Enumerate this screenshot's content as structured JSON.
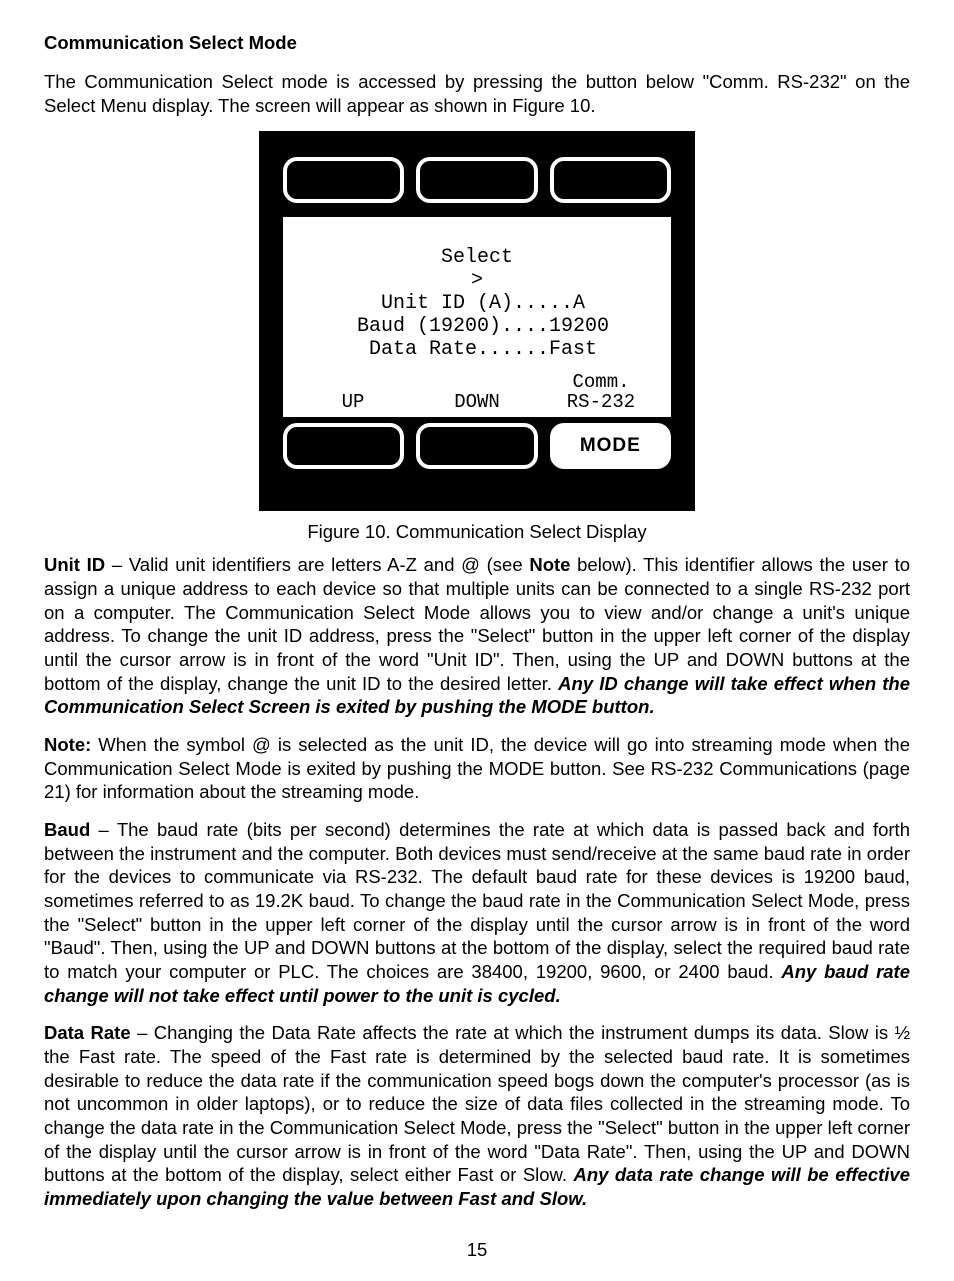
{
  "heading": "Communication Select Mode",
  "intro": "The Communication Select mode is accessed by pressing the button below \"Comm. RS-232\" on the Select Menu display. The screen will appear as shown in Figure 10.",
  "device": {
    "lcd": {
      "title": "Select",
      "cursor": ">",
      "lines": [
        " Unit ID (A).....A",
        " Baud (19200)....19200",
        " Data Rate......Fast"
      ],
      "soft_labels": {
        "left": "UP",
        "mid": "DOWN",
        "right_top": "Comm.",
        "right_bot": "RS-232"
      }
    },
    "bottom_button_label": "MODE"
  },
  "figure_caption": "Figure 10. Communication Select Display",
  "unit_id": {
    "label": "Unit ID",
    "text_a": " – Valid unit identifiers are letters A-Z and @ (see ",
    "note_word": "Note",
    "text_b": " below). This identifier allows the user to assign a unique address to each device so that multiple units can be connected to a single RS-232 port on a computer. The Communication Select Mode allows you to view and/or change a unit's unique address. To change the unit ID address, press the \"Select\" button in the upper left corner of the display until the cursor arrow is in front of the word \"Unit ID\". Then, using the UP and DOWN buttons at the bottom of the display, change the unit ID to the desired letter. ",
    "bold_italic": "Any ID change will take effect when the Communication Select Screen is exited by pushing the MODE button."
  },
  "note": {
    "label": "Note:",
    "text": " When the symbol @ is selected as the unit ID, the device will go into streaming mode when the Communication Select Mode is exited by pushing the MODE button. See RS-232 Communications (page 21) for information about the streaming mode."
  },
  "baud": {
    "label": "Baud",
    "text": " – The baud rate (bits per second) determines the rate at which data is passed back and forth between the instrument and the computer. Both devices must send/receive at the same baud rate in order for the devices to communicate via RS-232. The default baud rate for these devices is 19200 baud, sometimes referred to as 19.2K baud. To change the baud rate in the Communication Select Mode, press the \"Select\" button in the upper left corner of the display until the cursor arrow is in front of the word \"Baud\". Then, using the UP and DOWN buttons at the bottom of the display, select the required baud rate to match your computer or PLC. The choices are 38400, 19200, 9600, or 2400 baud. ",
    "bold_italic": "Any baud rate change will not take effect until power to the unit is cycled."
  },
  "data_rate": {
    "label": "Data Rate",
    "text": " – Changing the Data Rate affects the rate at which the instrument dumps its data. Slow is ½ the Fast rate. The speed of the Fast rate is determined by the selected baud rate. It is sometimes desirable to reduce the data rate if the communication speed bogs down the computer's processor (as is not uncommon in older laptops), or to reduce the size of data files collected in the streaming mode. To change the data rate in the Communication Select Mode, press the \"Select\" button in the upper left corner of the display until the cursor arrow is in front of the word \"Data Rate\".  Then, using the UP and DOWN buttons at the bottom of the display, select either Fast or Slow. ",
    "bold_italic": "Any data rate change will be effective immediately upon changing the value between Fast and Slow."
  },
  "page_number": "15"
}
